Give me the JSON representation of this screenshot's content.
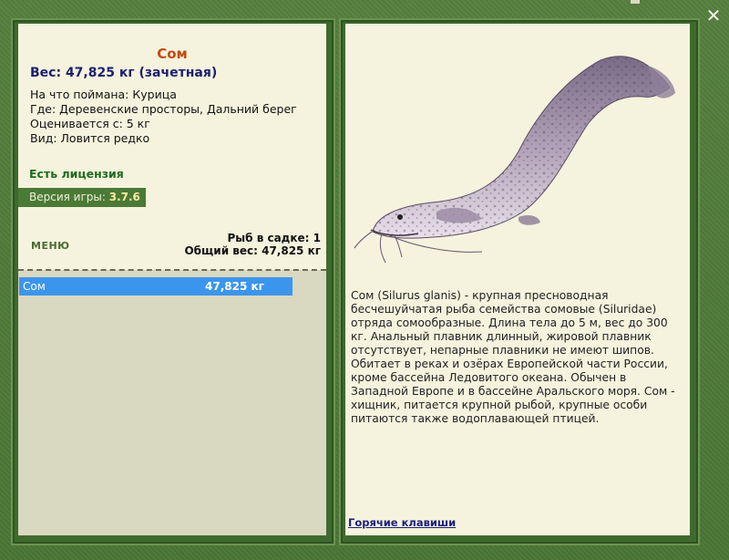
{
  "window": {
    "close_symbol": "✕"
  },
  "fish": {
    "name": "Сом",
    "weight_line": "Вес: 47,825 кг (зачетная)",
    "bait": "На что поймана: Курица",
    "place": "Где: Деревенские просторы, Дальний берег",
    "evaluated": "Оценивается с: 5 кг",
    "kind": "Вид: Ловится редко"
  },
  "license": "Есть лицензия",
  "version": {
    "label": "Версия игры:",
    "value": "3.7.6"
  },
  "menu_label": "МЕНЮ",
  "cage": {
    "count_line": "Рыб в садке: 1",
    "total_line": "Общий вес: 47,825 кг"
  },
  "catch_list": [
    {
      "name": "Сом",
      "weight": "47,825 кг"
    }
  ],
  "description": "Сом (Silurus glanis) - крупная пресноводная бесчешуйчатая рыба семейства сомовые (Siluridae) отряда сомообразные. Длина тела до 5 м, вес до 300 кг. Анальный плавник длинный, жировой плавник отсутствует, непарные плавники не имеют шипов. Обитает в реках и озёрах Европейской части России, кроме бассейна Ледовитого океана. Обычен в Западной Европе и в бассейне Аральского моря. Сом - хищник, питается крупной рыбой, крупные особи питаются также водоплавающей птицей.",
  "hotkeys_label": "Горячие клавиши",
  "colors": {
    "background": "#4f7a3a",
    "panel": "#f5f3dd",
    "title": "#c14a10",
    "weight": "#1a1f70",
    "license": "#1f6b1f",
    "selected_row": "#3b95ec"
  }
}
